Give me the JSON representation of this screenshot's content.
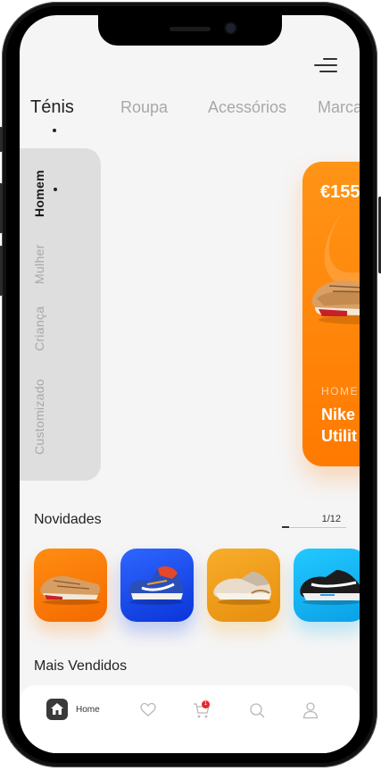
{
  "categories": [
    "Ténis",
    "Roupa",
    "Acessórios",
    "Marca"
  ],
  "active_category": "Ténis",
  "segments": [
    "Homem",
    "Mulher",
    "Criança",
    "Customizado"
  ],
  "active_segment": "Homem",
  "featured": {
    "price": "€155",
    "category": "HOME",
    "name": "Nike\nUtilit",
    "color": "#ff8a0a"
  },
  "novidades": {
    "title": "Novidades",
    "pager": "1/12",
    "progress": 0.11,
    "products": [
      {
        "icon": "orange-sneaker-icon",
        "bg": "#ff7a00"
      },
      {
        "icon": "blue-basketball-shoe-icon",
        "bg": "#1747e6"
      },
      {
        "icon": "beige-sneaker-icon",
        "bg": "#f2a21c"
      },
      {
        "icon": "black-white-sneaker-icon",
        "bg": "#14b8f0"
      }
    ]
  },
  "mais_vendidos": {
    "title": "Mais Vendidos"
  },
  "tabbar": {
    "home_label": "Home",
    "cart_badge": "1",
    "icons": [
      "home-icon",
      "heart-icon",
      "cart-icon",
      "search-icon",
      "user-icon"
    ]
  }
}
